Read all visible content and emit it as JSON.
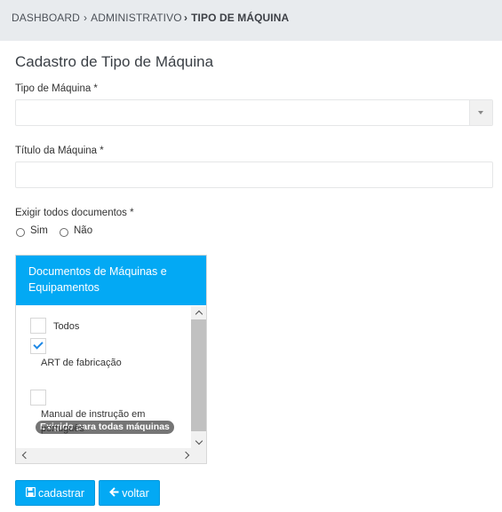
{
  "breadcrumb": {
    "items": [
      "DASHBOARD",
      "ADMINISTRATIVO",
      "TIPO DE MÁQUINA"
    ],
    "separator": "›"
  },
  "page": {
    "title": "Cadastro de Tipo de Máquina"
  },
  "form": {
    "tipo_label": "Tipo de Máquina *",
    "tipo_value": "",
    "titulo_label": "Título da Máquina *",
    "titulo_value": "",
    "exigir_label": "Exigir todos documentos *",
    "radio_sim": "Sim",
    "radio_nao": "Não"
  },
  "documents": {
    "header": "Documentos de Máquinas e Equipamentos",
    "items": [
      {
        "label": "Todos",
        "checked": false
      },
      {
        "label": "ART de fabricação",
        "checked": true,
        "badge": "Exigido para todas máquinas"
      },
      {
        "label": "Manual de instrução em português",
        "checked": false
      }
    ]
  },
  "buttons": {
    "save": "cadastrar",
    "back": "voltar"
  },
  "colors": {
    "accent": "#03a9f4",
    "breadcrumb_bg": "#e8ebee",
    "badge": "#757575"
  }
}
